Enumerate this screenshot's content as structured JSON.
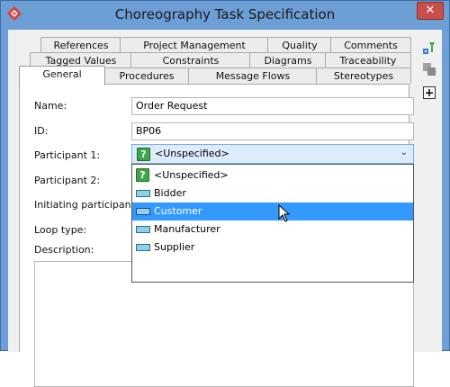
{
  "window": {
    "title": "Choreography Task Specification",
    "close_label": "✕"
  },
  "tabs": {
    "row1": [
      {
        "label": "References"
      },
      {
        "label": "Project Management"
      },
      {
        "label": "Quality"
      },
      {
        "label": "Comments"
      }
    ],
    "row2": [
      {
        "label": "Tagged Values"
      },
      {
        "label": "Constraints"
      },
      {
        "label": "Diagrams"
      },
      {
        "label": "Traceability"
      }
    ],
    "row3": [
      {
        "label": "General",
        "active": true
      },
      {
        "label": "Procedures"
      },
      {
        "label": "Message Flows"
      },
      {
        "label": "Stereotypes"
      }
    ]
  },
  "form": {
    "name_label": "Name:",
    "name_value": "Order Request",
    "id_label": "ID:",
    "id_value": "BP06",
    "participant1_label": "Participant 1:",
    "participant1_value": "<Unspecified>",
    "participant2_label": "Participant 2:",
    "initiating_label": "Initiating participant:",
    "loop_label": "Loop type:",
    "description_label": "Description:"
  },
  "dropdown": {
    "options": [
      {
        "label": "<Unspecified>",
        "icon": "question-icon"
      },
      {
        "label": "Bidder",
        "icon": "lane-icon"
      },
      {
        "label": "Customer",
        "icon": "lane-icon",
        "selected": true
      },
      {
        "label": "Manufacturer",
        "icon": "lane-icon"
      },
      {
        "label": "Supplier",
        "icon": "lane-icon"
      }
    ]
  },
  "colors": {
    "title_bar": "#6d9ed6",
    "selection": "#3399ff",
    "combo_highlight": "#dcecfc",
    "question_green": "#3ea54a",
    "lane_blue": "#8dd0e8"
  }
}
